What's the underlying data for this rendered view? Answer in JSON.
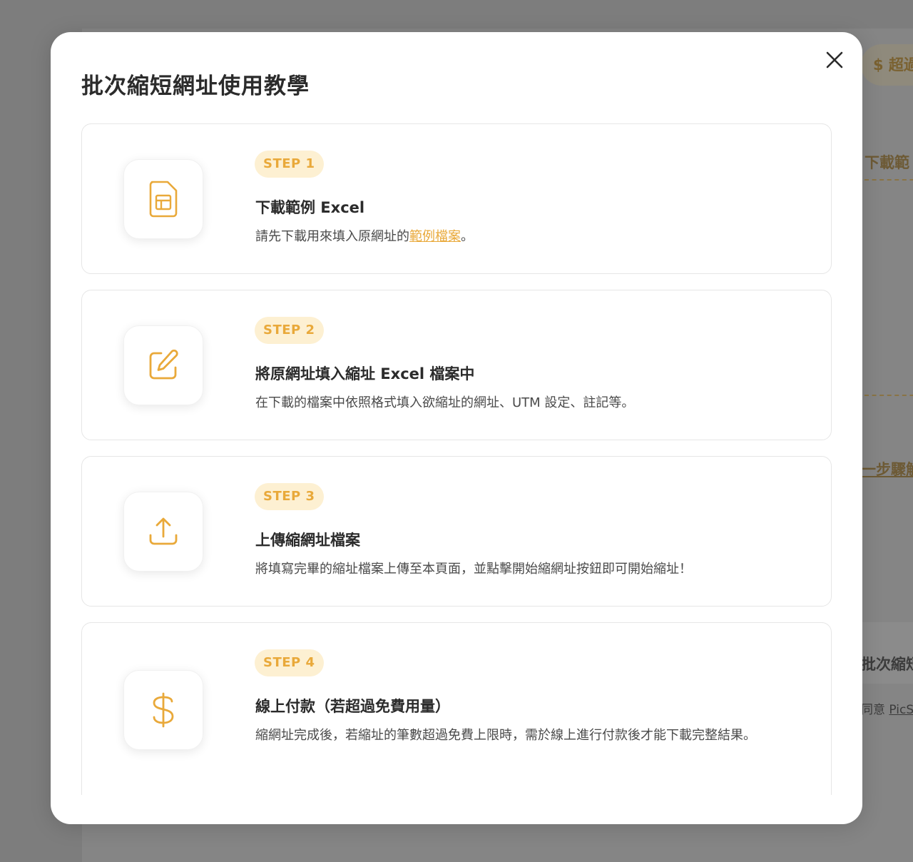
{
  "background": {
    "pill_label": "$ 超過",
    "heading_1": "下載範",
    "link_1": "一步驟解",
    "heading_2": "批次縮短",
    "agree_prefix": "同意",
    "agree_link": "PicSe"
  },
  "modal": {
    "title": "批次縮短網址使用教學",
    "close_icon": "close-icon",
    "accent_color": "#e9a93a",
    "badge_bg_color": "#fdf0d2",
    "steps": [
      {
        "badge": "STEP 1",
        "icon": "spreadsheet-file-icon",
        "title": "下載範例 Excel",
        "desc_before": "請先下載用來填入原網址的",
        "desc_link": "範例檔案",
        "desc_after": "。"
      },
      {
        "badge": "STEP 2",
        "icon": "edit-icon",
        "title": "將原網址填入縮址 Excel 檔案中",
        "desc": "在下載的檔案中依照格式填入欲縮址的網址、UTM 設定、註記等。"
      },
      {
        "badge": "STEP 3",
        "icon": "upload-icon",
        "title": "上傳縮網址檔案",
        "desc": "將填寫完畢的縮址檔案上傳至本頁面，並點擊開始縮網址按鈕即可開始縮址！"
      },
      {
        "badge": "STEP 4",
        "icon": "dollar-icon",
        "title": "線上付款（若超過免費用量）",
        "desc": "縮網址完成後，若縮址的筆數超過免費上限時，需於線上進行付款後才能下載完整結果。"
      }
    ]
  }
}
